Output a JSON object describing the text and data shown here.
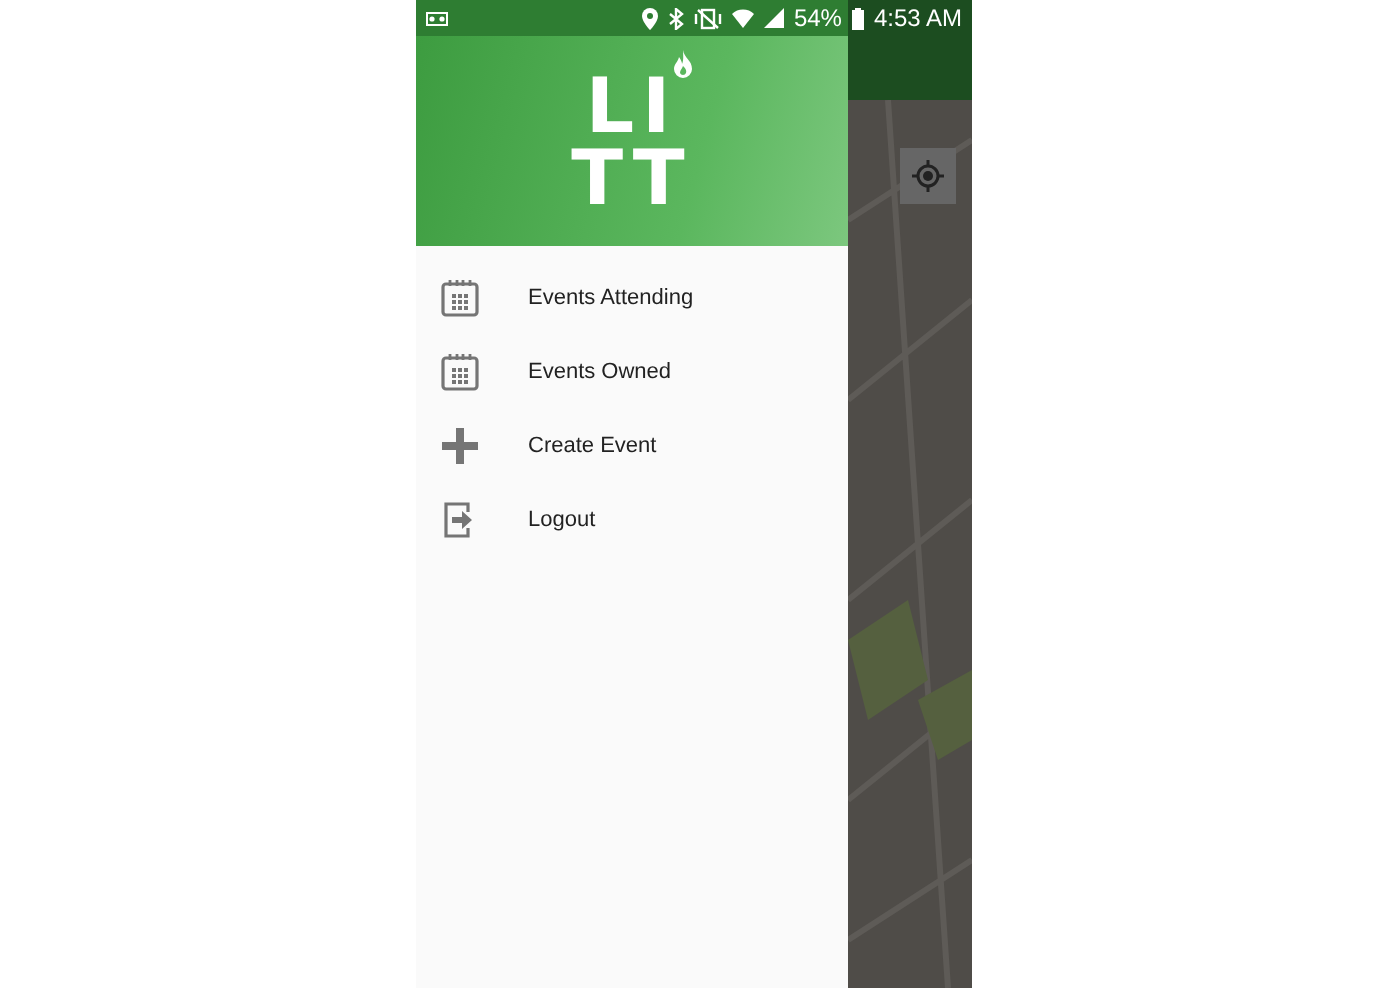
{
  "status_bar": {
    "battery": "54%",
    "time": "4:53 AM"
  },
  "drawer": {
    "logo": [
      "LI",
      "TT"
    ],
    "items": [
      {
        "label": "Events Attending",
        "kind": "calendar"
      },
      {
        "label": "Events Owned",
        "kind": "calendar"
      },
      {
        "label": "Create Event",
        "kind": "add"
      },
      {
        "label": "Logout",
        "kind": "logout"
      }
    ]
  }
}
